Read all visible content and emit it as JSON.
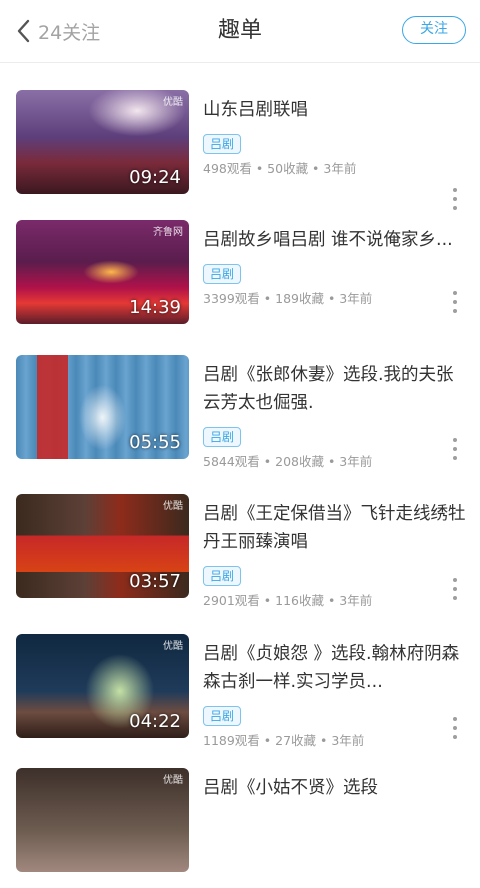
{
  "header": {
    "back_label": "24关注",
    "title": "趣单",
    "follow_label": "关注"
  },
  "items": [
    {
      "title": "山东吕剧联唱",
      "tag": "吕剧",
      "meta": "498观看 • 50收藏 • 3年前",
      "duration": "09:24",
      "watermark": "优酷",
      "colors": [
        "#6f5a8a",
        "#d9c7d6",
        "#c0392b"
      ]
    },
    {
      "title": "吕剧故乡唱吕剧 谁不说俺家乡...",
      "tag": "吕剧",
      "meta": "3399观看 • 189收藏 • 3年前",
      "duration": "14:39",
      "watermark": "齐鲁网",
      "colors": [
        "#5a1d4d",
        "#c2185b",
        "#e53935"
      ]
    },
    {
      "title": "吕剧《张郎休妻》选段.我的夫张云芳太也倔强.",
      "tag": "吕剧",
      "meta": "5844观看 • 208收藏 • 3年前",
      "duration": "05:55",
      "watermark": "",
      "colors": [
        "#4a89b8",
        "#7fb3d8",
        "#c62828"
      ]
    },
    {
      "title": "吕剧《王定保借当》飞针走线绣牡丹王丽臻演唱",
      "tag": "吕剧",
      "meta": "2901观看 • 116收藏 • 3年前",
      "duration": "03:57",
      "watermark": "优酷",
      "colors": [
        "#3b2a1e",
        "#8e2b1b",
        "#d84315"
      ]
    },
    {
      "title": "吕剧《贞娘怨 》选段.翰林府阴森森古刹一样.实习学员...",
      "tag": "吕剧",
      "meta": "1189观看 • 27收藏 • 3年前",
      "duration": "04:22",
      "watermark": "优酷",
      "colors": [
        "#1f3b5a",
        "#9ccc65",
        "#6d4c41"
      ]
    },
    {
      "title": "吕剧《小姑不贤》选段",
      "tag": "",
      "meta": "",
      "duration": "",
      "watermark": "优酷",
      "colors": [
        "#3d2f2a",
        "#6d5c50",
        "#a1887f"
      ]
    }
  ]
}
